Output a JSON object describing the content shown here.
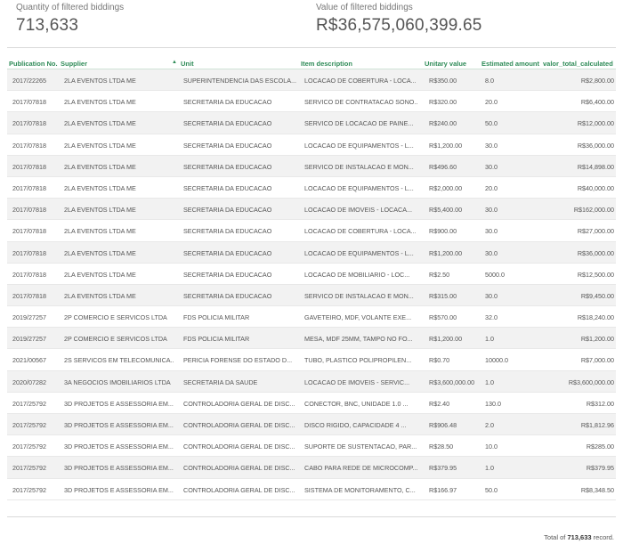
{
  "kpis": {
    "quantity_label": "Quantity of filtered biddings",
    "quantity_value": "713,633",
    "value_label": "Value of filtered biddings",
    "value_value": "R$36,575,060,399.65"
  },
  "table": {
    "headers": {
      "publication": "Publication No.",
      "supplier": "Supplier",
      "unit": "Unit",
      "description": "Item description",
      "unitary": "Unitary value",
      "estimated": "Estimated amount",
      "total": "valor_total_calculated"
    },
    "sort_icon": "sort-asc-icon",
    "rows": [
      [
        "2017/22265",
        "2LA EVENTOS LTDA ME",
        "SUPERINTENDENCIA DAS ESCOLA...",
        "LOCACAO DE COBERTURA - LOCA...",
        "R$350.00",
        "8.0",
        "R$2,800.00"
      ],
      [
        "2017/07818",
        "2LA EVENTOS LTDA ME",
        "SECRETARIA DA EDUCACAO",
        "SERVICO DE CONTRATACAO SONO...",
        "R$320.00",
        "20.0",
        "R$6,400.00"
      ],
      [
        "2017/07818",
        "2LA EVENTOS LTDA ME",
        "SECRETARIA DA EDUCACAO",
        "SERVICO DE LOCACAO DE PAINE...",
        "R$240.00",
        "50.0",
        "R$12,000.00"
      ],
      [
        "2017/07818",
        "2LA EVENTOS LTDA ME",
        "SECRETARIA DA EDUCACAO",
        "LOCACAO DE EQUIPAMENTOS - L...",
        "R$1,200.00",
        "30.0",
        "R$36,000.00"
      ],
      [
        "2017/07818",
        "2LA EVENTOS LTDA ME",
        "SECRETARIA DA EDUCACAO",
        "SERVICO DE INSTALACAO E MON...",
        "R$496.60",
        "30.0",
        "R$14,898.00"
      ],
      [
        "2017/07818",
        "2LA EVENTOS LTDA ME",
        "SECRETARIA DA EDUCACAO",
        "LOCACAO DE EQUIPAMENTOS - L...",
        "R$2,000.00",
        "20.0",
        "R$40,000.00"
      ],
      [
        "2017/07818",
        "2LA EVENTOS LTDA ME",
        "SECRETARIA DA EDUCACAO",
        "LOCACAO DE IMOVEIS - LOCACA...",
        "R$5,400.00",
        "30.0",
        "R$162,000.00"
      ],
      [
        "2017/07818",
        "2LA EVENTOS LTDA ME",
        "SECRETARIA DA EDUCACAO",
        "LOCACAO DE COBERTURA - LOCA...",
        "R$900.00",
        "30.0",
        "R$27,000.00"
      ],
      [
        "2017/07818",
        "2LA EVENTOS LTDA ME",
        "SECRETARIA DA EDUCACAO",
        "LOCACAO DE EQUIPAMENTOS - L...",
        "R$1,200.00",
        "30.0",
        "R$36,000.00"
      ],
      [
        "2017/07818",
        "2LA EVENTOS LTDA ME",
        "SECRETARIA DA EDUCACAO",
        "LOCACAO DE MOBILIARIO - LOC...",
        "R$2.50",
        "5000.0",
        "R$12,500.00"
      ],
      [
        "2017/07818",
        "2LA EVENTOS LTDA ME",
        "SECRETARIA DA EDUCACAO",
        "SERVICO DE INSTALACAO E MON...",
        "R$315.00",
        "30.0",
        "R$9,450.00"
      ],
      [
        "2019/27257",
        "2P COMERCIO E SERVICOS LTDA",
        "FDS POLICIA MILITAR",
        "GAVETEIRO, MDF, VOLANTE EXE...",
        "R$570.00",
        "32.0",
        "R$18,240.00"
      ],
      [
        "2019/27257",
        "2P COMERCIO E SERVICOS LTDA",
        "FDS POLICIA MILITAR",
        "MESA, MDF 25MM, TAMPO NO FO...",
        "R$1,200.00",
        "1.0",
        "R$1,200.00"
      ],
      [
        "2021/00567",
        "2S SERVICOS EM TELECOMUNICA...",
        "PERICIA FORENSE DO ESTADO D...",
        "TUBO, PLASTICO POLIPROPILEN...",
        "R$0.70",
        "10000.0",
        "R$7,000.00"
      ],
      [
        "2020/07282",
        "3A NEGOCIOS IMOBILIARIOS LTDA",
        "SECRETARIA DA SAUDE",
        "LOCACAO DE IMOVEIS - SERVIC...",
        "R$3,600,000.00",
        "1.0",
        "R$3,600,000.00"
      ],
      [
        "2017/25792",
        "3D PROJETOS E ASSESSORIA EM...",
        "CONTROLADORIA GERAL DE DISC...",
        "CONECTOR, BNC, UNIDADE 1.0 ...",
        "R$2.40",
        "130.0",
        "R$312.00"
      ],
      [
        "2017/25792",
        "3D PROJETOS E ASSESSORIA EM...",
        "CONTROLADORIA GERAL DE DISC...",
        "DISCO RIGIDO, CAPACIDADE 4 ...",
        "R$906.48",
        "2.0",
        "R$1,812.96"
      ],
      [
        "2017/25792",
        "3D PROJETOS E ASSESSORIA EM...",
        "CONTROLADORIA GERAL DE DISC...",
        "SUPORTE DE SUSTENTACAO, PAR...",
        "R$28.50",
        "10.0",
        "R$285.00"
      ],
      [
        "2017/25792",
        "3D PROJETOS E ASSESSORIA EM...",
        "CONTROLADORIA GERAL DE DISC...",
        "CABO PARA REDE DE MICROCOMP...",
        "R$379.95",
        "1.0",
        "R$379.95"
      ],
      [
        "2017/25792",
        "3D PROJETOS E ASSESSORIA EM...",
        "CONTROLADORIA GERAL DE DISC...",
        "SISTEMA DE MONITORAMENTO, C...",
        "R$166.97",
        "50.0",
        "R$8,348.50"
      ]
    ]
  },
  "footer": {
    "prefix": "Total of",
    "count": "713,633",
    "suffix": "record."
  }
}
